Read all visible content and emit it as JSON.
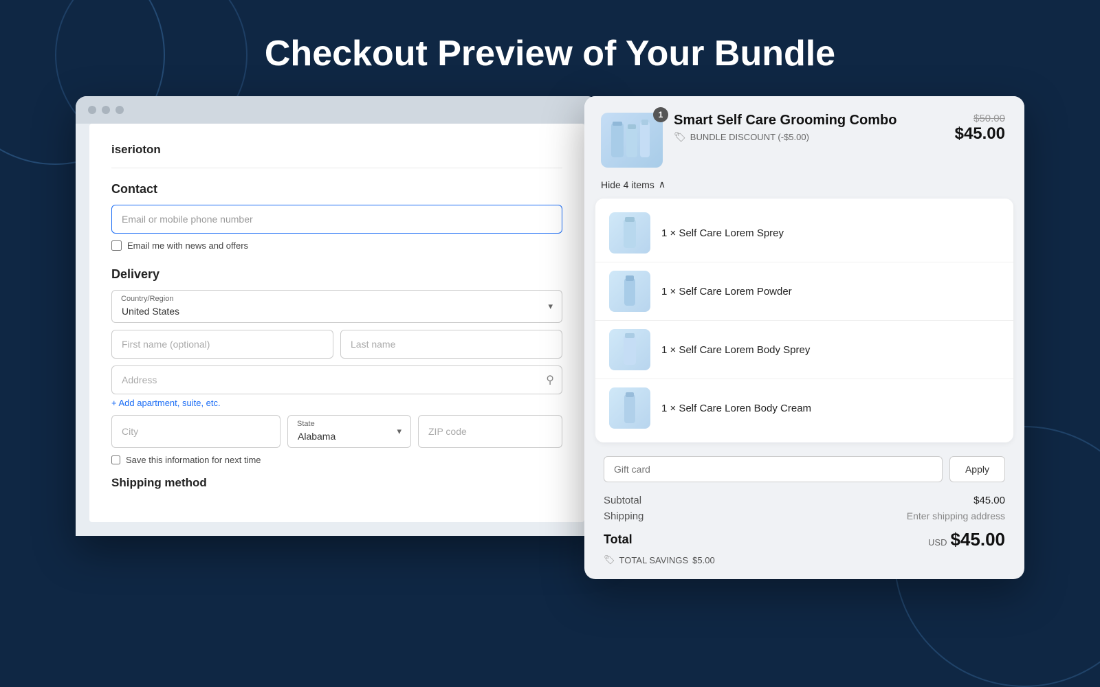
{
  "page": {
    "title": "Checkout Preview of Your Bundle",
    "background_color": "#0f2744"
  },
  "checkout_window": {
    "store_name": "iserioton",
    "contact": {
      "section_label": "Contact",
      "email_placeholder": "Email or mobile phone number",
      "newsletter_checkbox_label": "Email me with news and offers"
    },
    "delivery": {
      "section_label": "Delivery",
      "country_label": "Country/Region",
      "country_value": "United States",
      "first_name_placeholder": "First name (optional)",
      "last_name_placeholder": "Last name",
      "address_placeholder": "Address",
      "add_apartment_label": "+ Add apartment, suite, etc.",
      "city_placeholder": "City",
      "state_label": "State",
      "state_value": "Alabama",
      "zip_placeholder": "ZIP code",
      "save_info_label": "Save this information for next time"
    },
    "shipping_method_label": "Shipping method"
  },
  "order_panel": {
    "bundle": {
      "name": "Smart Self Care Grooming Combo",
      "badge_count": "1",
      "discount_label": "BUNDLE DISCOUNT (-$5.00)",
      "original_price": "$50.00",
      "sale_price": "$45.00",
      "hide_items_label": "Hide 4 items",
      "items": [
        {
          "name": "1 × Self Care Lorem Sprey",
          "id": "item-1"
        },
        {
          "name": "1 × Self Care Lorem Powder",
          "id": "item-2"
        },
        {
          "name": "1 × Self Care Lorem Body Sprey",
          "id": "item-3"
        },
        {
          "name": "1 × Self Care Loren Body Cream",
          "id": "item-4"
        }
      ]
    },
    "gift_card_placeholder": "Gift card",
    "apply_button_label": "Apply",
    "subtotal_label": "Subtotal",
    "subtotal_value": "$45.00",
    "shipping_label": "Shipping",
    "shipping_value": "Enter shipping address",
    "total_label": "Total",
    "total_currency": "USD",
    "total_amount": "$45.00",
    "savings_label": "TOTAL SAVINGS",
    "savings_amount": "$5.00"
  }
}
